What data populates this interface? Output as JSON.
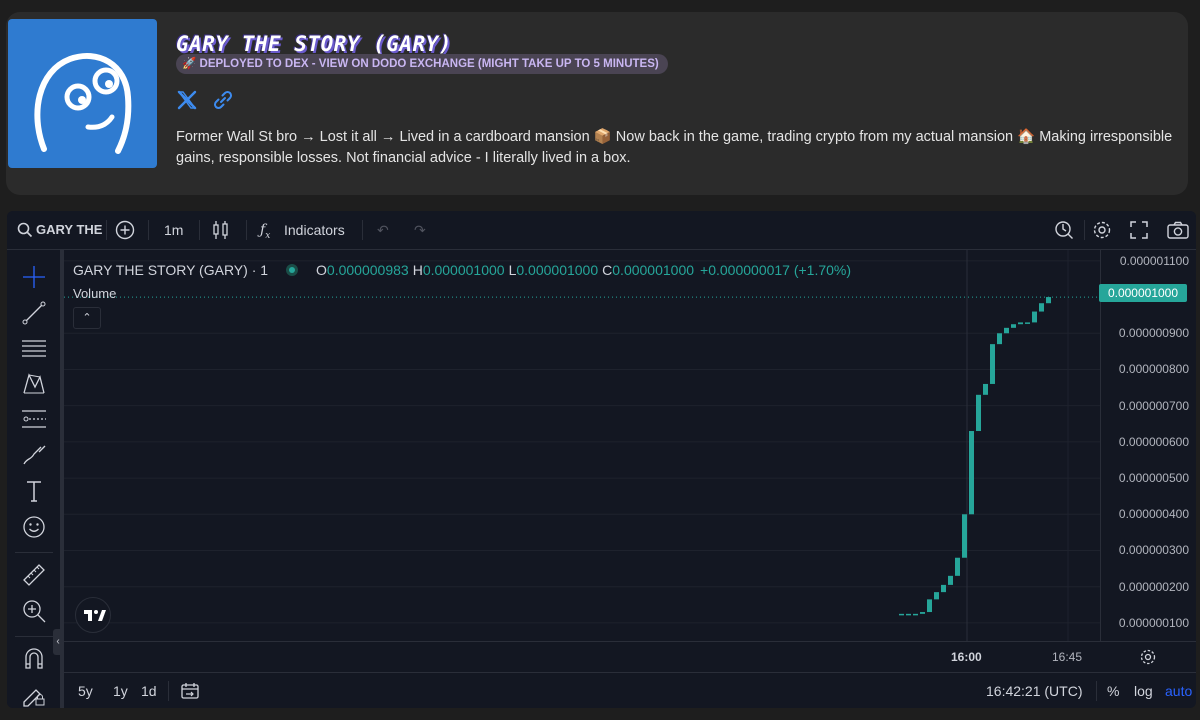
{
  "token": {
    "title": "GARY THE STORY (GARY)",
    "badge": "🚀 DEPLOYED TO DEX - VIEW ON DODO EXCHANGE (MIGHT TAKE UP TO 5 MINUTES)",
    "description": "Former Wall St bro → Lost it all → Lived in a cardboard mansion 📦 Now back in the game, trading crypto from my actual mansion 🏠 Making irresponsible gains, responsible losses. Not financial advice - I literally lived in a box.",
    "socials": [
      "x-icon",
      "link-icon"
    ]
  },
  "toolbar": {
    "symbol": "GARY THE",
    "interval": "1m",
    "indicators_label": "Indicators"
  },
  "legend": {
    "title": "GARY THE STORY (GARY) · 1",
    "o_key": "O",
    "o_val": "0.000000983",
    "h_key": "H",
    "h_val": "0.000001000",
    "l_key": "L",
    "l_val": "0.000001000",
    "c_key": "C",
    "c_val": "0.000001000",
    "change": "+0.000000017 (+1.70%)",
    "volume_label": "Volume"
  },
  "price_scale": {
    "labels": [
      "0.000001100",
      "0.000000900",
      "0.000000800",
      "0.000000700",
      "0.000000600",
      "0.000000500",
      "0.000000400",
      "0.000000300",
      "0.000000200",
      "0.000000100"
    ],
    "last_price": "0.000001000"
  },
  "time_axis": {
    "labels": [
      "16:00",
      "16:45"
    ]
  },
  "bottom_bar": {
    "ranges": [
      "5y",
      "1y",
      "1d"
    ],
    "clock": "16:42:21 (UTC)",
    "percent": "%",
    "log": "log",
    "auto": "auto"
  },
  "colors": {
    "up": "#26a69a",
    "accent": "#2962ff",
    "bg": "#131722",
    "page_bg": "#1e1e1e",
    "card_bg": "#2b2b2b",
    "avatar_bg": "#2f7bd0"
  },
  "chart_data": {
    "type": "line",
    "title": "GARY THE STORY (GARY) · 1",
    "xlabel": "",
    "ylabel": "",
    "x_ticks": [
      "16:00",
      "16:45"
    ],
    "ylim": [
      5e-08,
      1.13e-06
    ],
    "series": [
      {
        "name": "GARY THE STORY (GARY)",
        "values": [
          1.25e-07,
          1.25e-07,
          1.25e-07,
          1.3e-07,
          1.65e-07,
          1.85e-07,
          2.05e-07,
          2.3e-07,
          2.8e-07,
          4e-07,
          6.3e-07,
          7.3e-07,
          7.6e-07,
          8.7e-07,
          9e-07,
          9.15e-07,
          9.25e-07,
          9.3e-07,
          9.3e-07,
          9.6e-07,
          9.83e-07,
          1e-06
        ]
      }
    ]
  }
}
